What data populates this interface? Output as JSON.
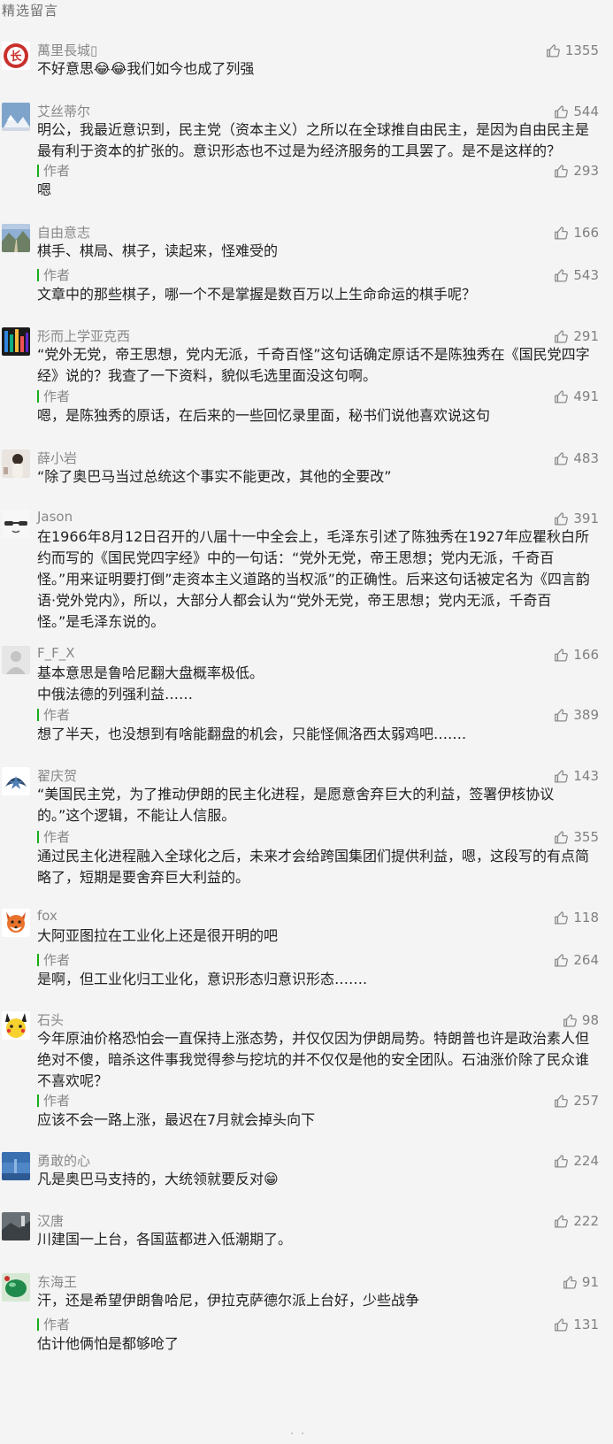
{
  "section_title": "精选留言",
  "comments": [
    {
      "nickname": "萬里長城▯",
      "likes": "1355",
      "avatar": "red-emblem-avatar",
      "content": "不好意思😂😂我们如今也成了列强",
      "reply": null
    },
    {
      "nickname": "艾丝蒂尔",
      "likes": "544",
      "avatar": "snow-mountain-avatar",
      "content": "明公，我最近意识到，民主党（资本主义）之所以在全球推自由民主，是因为自由民主是最有利于资本的扩张的。意识形态也不过是为经济服务的工具罢了。是不是这样的？",
      "reply": {
        "label": "作者",
        "likes": "293",
        "text": "嗯"
      }
    },
    {
      "nickname": "自由意志",
      "likes": "166",
      "avatar": "mountain-road-avatar",
      "content": "棋手、棋局、棋子，读起来，怪难受的",
      "reply": {
        "label": "作者",
        "likes": "543",
        "text": "文章中的那些棋子，哪一个不是掌握是数百万以上生命命运的棋手呢？"
      }
    },
    {
      "nickname": "形而上学亚克西",
      "likes": "291",
      "avatar": "colorful-pattern-avatar",
      "content": "“党外无党，帝王思想，党内无派，千奇百怪”这句话确定原话不是陈独秀在《国民党四字经》说的？我查了一下资料，貌似毛选里面没这句啊。",
      "reply": {
        "label": "作者",
        "likes": "491",
        "text": "嗯，是陈独秀的原话，在后来的一些回忆录里面，秘书们说他喜欢说这句"
      }
    },
    {
      "nickname": "薛小岩",
      "likes": "483",
      "avatar": "person-photo-avatar",
      "content": "“除了奥巴马当过总统这个事实不能更改，其他的全要改”",
      "reply": null
    },
    {
      "nickname": "Jason",
      "likes": "391",
      "avatar": "sunglasses-avatar",
      "content": "在1966年8月12日召开的八届十一中全会上，毛泽东引述了陈独秀在1927年应瞿秋白所约而写的《国民党四字经》中的一句话：“党外无党，帝王思想；党内无派，千奇百怪。”用来证明要打倒”走资本主义道路的当权派”的正确性。后来这句话被定名为《四言韵语·党外党内》，所以，大部分人都会认为“党外无党，帝王思想；党内无派，千奇百怪。”是毛泽东说的。",
      "reply": null
    },
    {
      "nickname": "F_F_X",
      "likes": "166",
      "avatar": "default-grey-avatar",
      "content": "基本意思是鲁哈尼翻大盘概率极低。\n中俄法德的列强利益……",
      "reply": {
        "label": "作者",
        "likes": "389",
        "text": "想了半天，也没想到有啥能翻盘的机会，只能怪佩洛西太弱鸡吧……."
      }
    },
    {
      "nickname": "翟庆贺",
      "likes": "143",
      "avatar": "star-emblem-avatar",
      "content": "“美国民主党，为了推动伊朗的民主化进程，是愿意舍弃巨大的利益，签署伊核协议的。”这个逻辑，不能让人信服。",
      "reply": {
        "label": "作者",
        "likes": "355",
        "text": "通过民主化进程融入全球化之后，未来才会给跨国集团们提供利益，嗯，这段写的有点简略了，短期是要舍弃巨大利益的。"
      }
    },
    {
      "nickname": "fox",
      "likes": "118",
      "avatar": "fox-avatar",
      "content": "大阿亚图拉在工业化上还是很开明的吧",
      "reply": {
        "label": "作者",
        "likes": "264",
        "text": "是啊，但工业化归工业化，意识形态归意识形态……."
      }
    },
    {
      "nickname": "石头",
      "likes": "98",
      "avatar": "pikachu-avatar",
      "content": "今年原油价格恐怕会一直保持上涨态势，并仅仅因为伊朗局势。特朗普也许是政治素人但绝对不傻，暗杀这件事我觉得参与挖坑的并不仅仅是他的安全团队。石油涨价除了民众谁不喜欢呢？",
      "reply": {
        "label": "作者",
        "likes": "257",
        "text": "应该不会一路上涨，最迟在7月就会掉头向下"
      }
    },
    {
      "nickname": "勇敢的心",
      "likes": "224",
      "avatar": "blue-sky-avatar",
      "content": "凡是奥巴马支持的，大统领就要反对😁",
      "reply": null
    },
    {
      "nickname": "汉唐",
      "likes": "222",
      "avatar": "dark-landscape-avatar",
      "content": "川建国一上台，各国蓝都进入低潮期了。",
      "reply": null
    },
    {
      "nickname": "东海王",
      "likes": "91",
      "avatar": "green-jade-avatar",
      "content": "汗，还是希望伊朗鲁哈尼，伊拉克萨德尔派上台好，少些战争",
      "reply": {
        "label": "作者",
        "likes": "131",
        "text": "估计他俩怕是都够呛了"
      }
    }
  ],
  "colors": {
    "background": "#f4f4f4",
    "text": "#222222",
    "muted": "#888888",
    "author_bar": "#1aad19"
  }
}
